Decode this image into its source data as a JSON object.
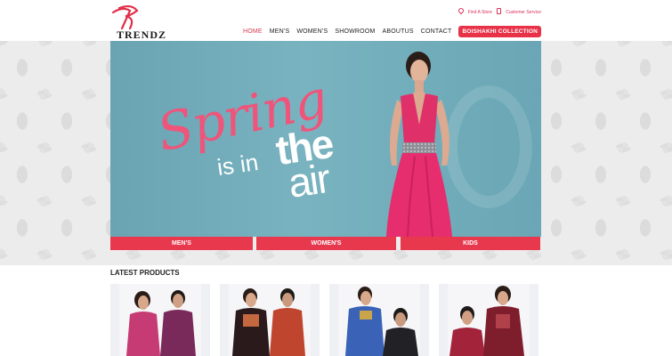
{
  "brand": {
    "logo_text": "TRENDZ"
  },
  "utility": {
    "find_store": "Find A Store",
    "customer_service": "Customer Service"
  },
  "nav": {
    "items": [
      "HOME",
      "MEN'S",
      "WOMEN'S",
      "SHOWROOM",
      "ABOUTUS",
      "CONTACT"
    ],
    "cta": "BOISHAKHI COLLECTION",
    "active_index": 0
  },
  "hero": {
    "line1": "Spring",
    "line2": "is in",
    "line3": "the",
    "line4": "air"
  },
  "categories": [
    "MEN'S",
    "WOMEN'S",
    "KIDS"
  ],
  "latest": {
    "title": "LATEST PRODUCTS"
  },
  "colors": {
    "accent": "#e8384e",
    "hero_bg": "#74aebc",
    "spring_pink": "#f0547a"
  }
}
